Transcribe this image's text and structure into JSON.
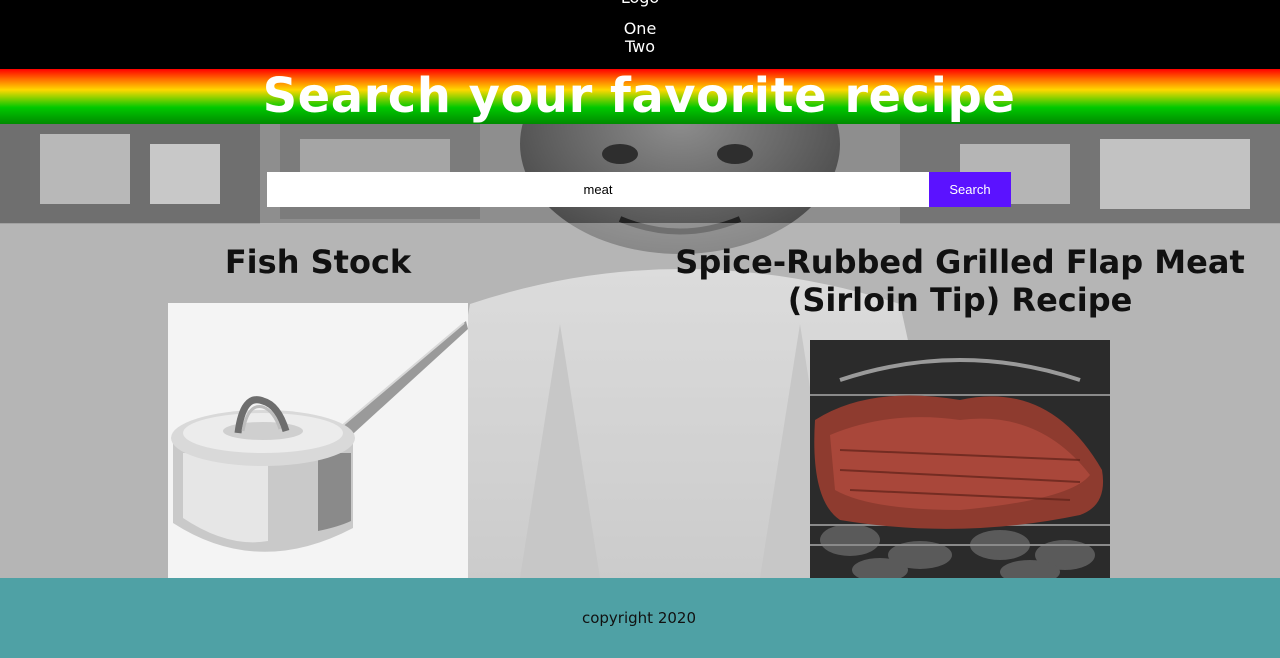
{
  "header": {
    "logo_text": "Logo",
    "nav": [
      "One",
      "Two"
    ]
  },
  "banner": {
    "title": "Search your favorite recipe"
  },
  "search": {
    "value": "meat",
    "button_label": "Search"
  },
  "results": [
    {
      "title": "Fish Stock",
      "image_icon": "saucepan-photo"
    },
    {
      "title": "Spice-Rubbed Grilled Flap Meat (Sirloin Tip) Recipe",
      "image_icon": "grilled-meat-photo"
    }
  ],
  "footer": {
    "copyright": "copyright 2020"
  },
  "colors": {
    "header_bg": "#000000",
    "search_button": "#5b12ff",
    "footer_bg": "#4fa1a5",
    "title_text": "#ffffff"
  }
}
